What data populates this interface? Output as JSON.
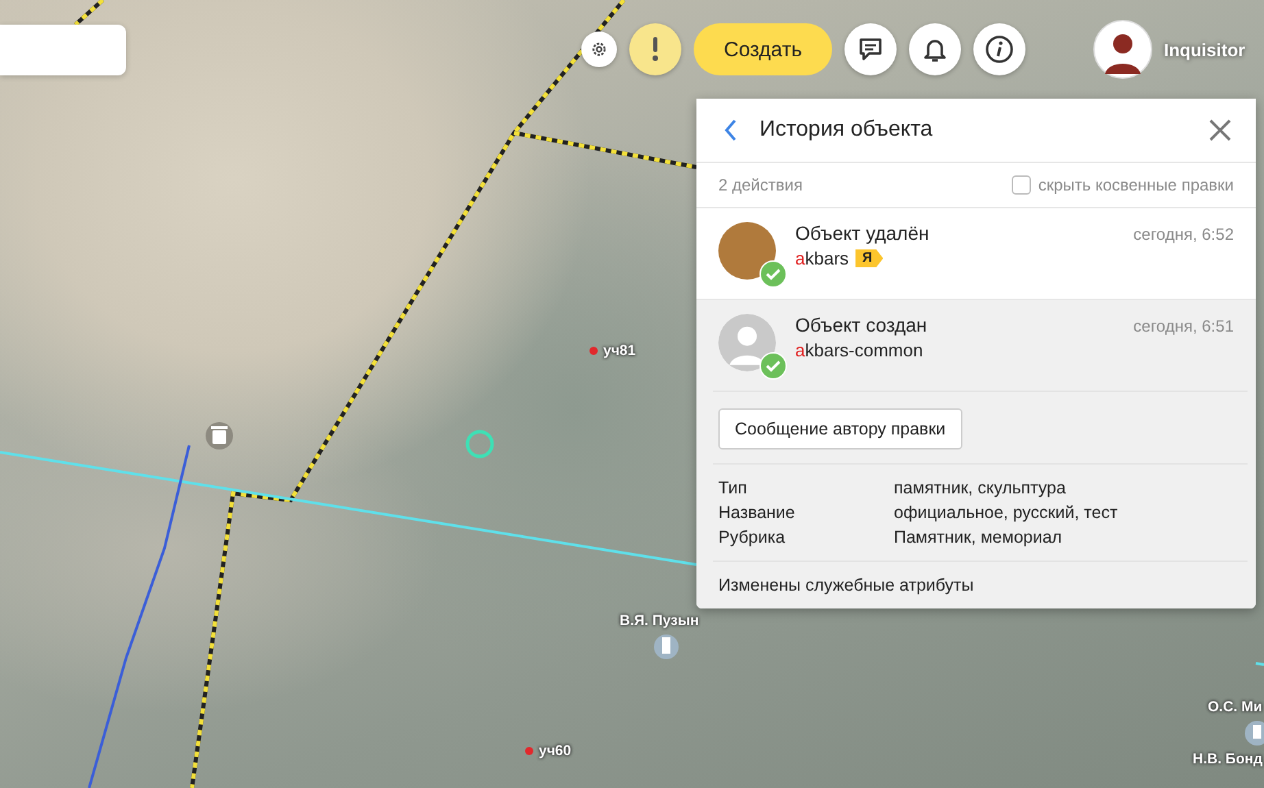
{
  "map": {
    "labels": [
      {
        "text": "уч81",
        "kind": "plot"
      },
      {
        "text": "В.Я. Пузын",
        "kind": "monument"
      },
      {
        "text": "уч60",
        "kind": "plot"
      },
      {
        "text": "О.С. Ми",
        "kind": "monument"
      },
      {
        "text": "Н.В. Бонд",
        "kind": "monument"
      }
    ]
  },
  "toolbar": {
    "create_label": "Создать",
    "user_name": "Inquisitor"
  },
  "panel": {
    "title": "История объекта",
    "count": "2 действия",
    "hide_indirect": {
      "label": "скрыть косвенные правки",
      "checked": false
    },
    "entries": [
      {
        "action": "Объект удалён",
        "user": "akbars",
        "time": "сегодня, 6:52",
        "kind": "photo",
        "badge": "Я",
        "approved": true,
        "selected": false
      },
      {
        "action": "Объект создан",
        "user": "akbars-common",
        "time": "сегодня, 6:51",
        "kind": "default",
        "approved": true,
        "selected": true
      }
    ],
    "message_button": "Сообщение автору правки",
    "attributes": [
      {
        "name": "Тип",
        "value": "памятник, скульптура"
      },
      {
        "name": "Название",
        "value": "официальное, русский, тест"
      },
      {
        "name": "Рубрика",
        "value": "Памятник, мемориал"
      }
    ],
    "note": "Изменены служебные атрибуты"
  }
}
